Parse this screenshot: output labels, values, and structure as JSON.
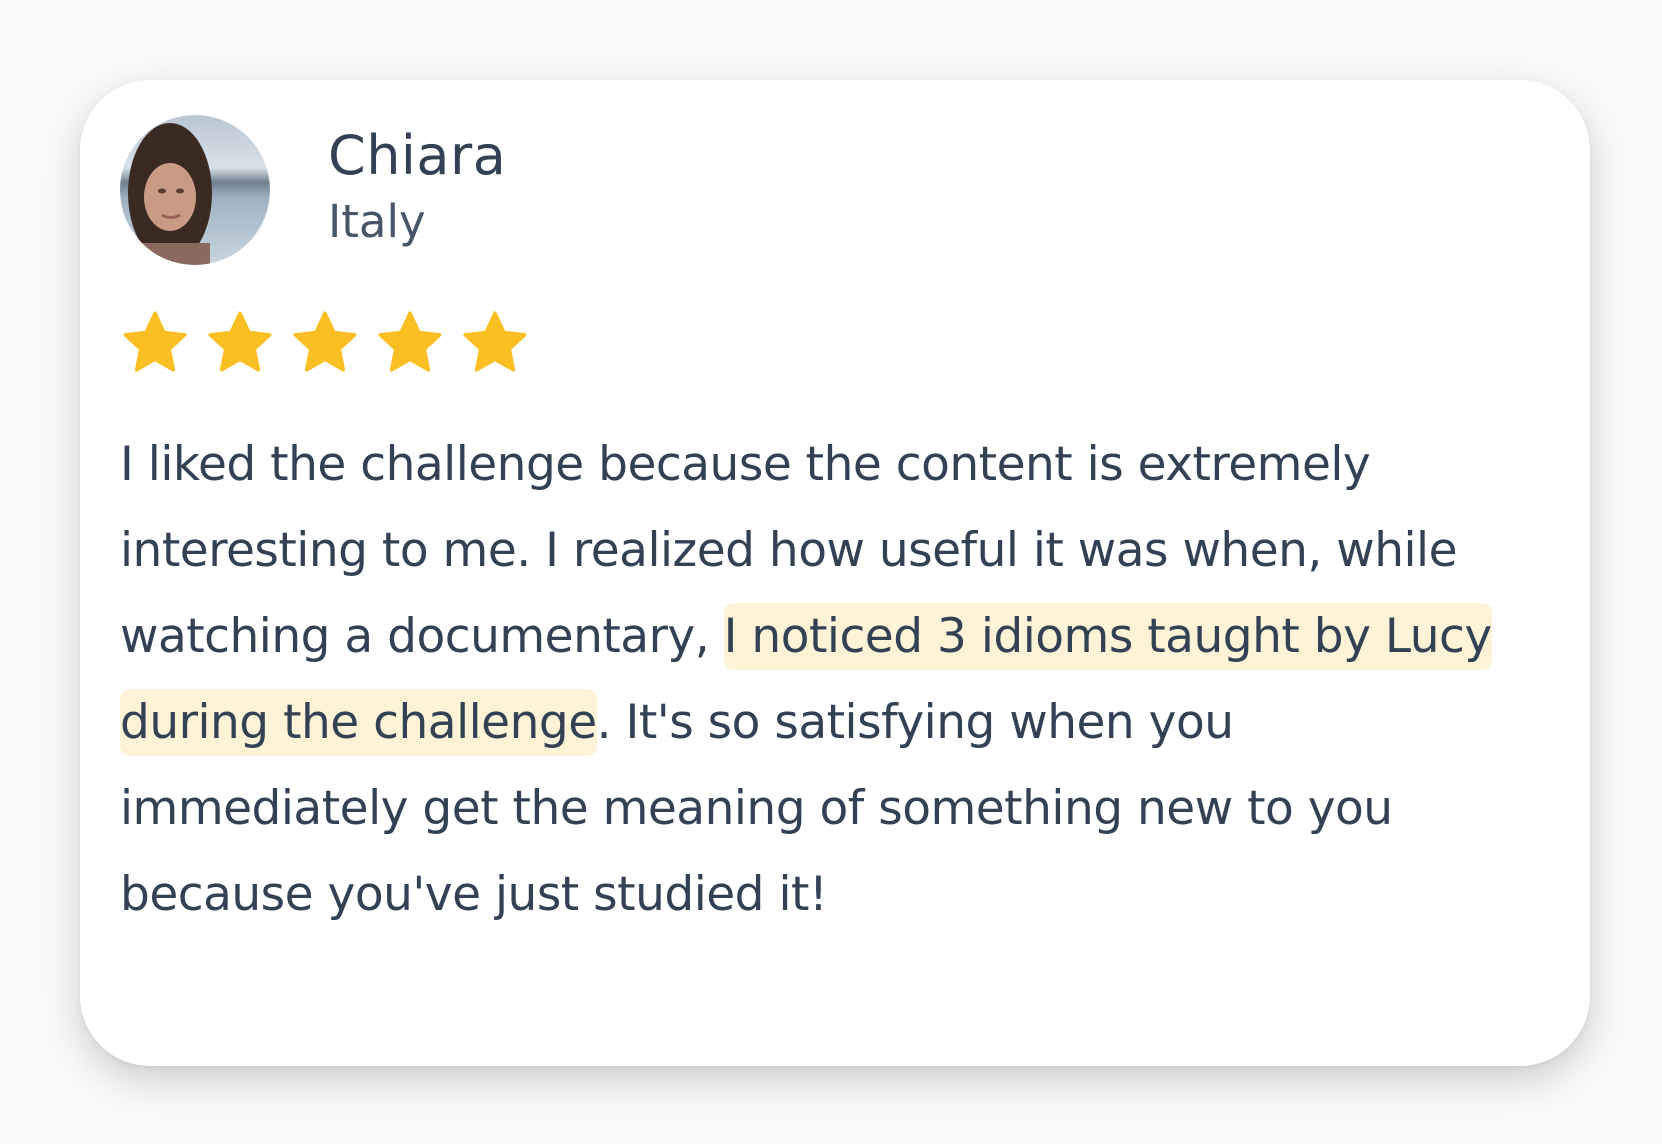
{
  "reviewer": {
    "name": "Chiara",
    "country": "Italy"
  },
  "rating": {
    "stars": 5,
    "max": 5,
    "color": "#fbbf24"
  },
  "review": {
    "text_before": "I liked the challenge because the content is extremely interesting to me. I realized how useful it was when, while watching a documentary, ",
    "highlight": "I noticed 3 idioms taught by Lucy during the challenge",
    "text_after": ". It's so satisfying when you immediately get the meaning of something new to you because you've just studied it!",
    "highlight_color": "#fef3d6"
  },
  "colors": {
    "text": "#334155",
    "subtext": "#475569",
    "card": "#ffffff",
    "background": "#fafafa"
  }
}
